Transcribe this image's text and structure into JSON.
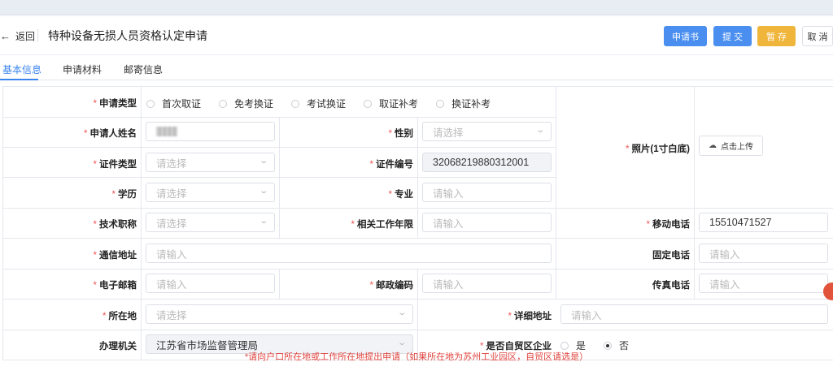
{
  "header": {
    "back_icon": "←",
    "back_label": "返回",
    "title": "特种设备无损人员资格认定申请",
    "buttons": {
      "apply_doc": "申请书",
      "submit": "提 交",
      "save_draft": "暂 存",
      "cancel": "取 消"
    },
    "colors": {
      "primary": "#4a8ff0",
      "warning": "#f0b53b"
    }
  },
  "tabs": [
    {
      "label": "基本信息",
      "active": true
    },
    {
      "label": "申请材料",
      "active": false
    },
    {
      "label": "邮寄信息",
      "active": false
    }
  ],
  "form": {
    "apply_type": {
      "label": "申请类型",
      "options": [
        "首次取证",
        "免考换证",
        "考试换证",
        "取证补考",
        "换证补考"
      ]
    },
    "applicant_name": {
      "label": "申请人姓名",
      "value": ""
    },
    "gender": {
      "label": "性别",
      "placeholder": "请选择"
    },
    "photo": {
      "label": "照片(1寸白底)",
      "upload_label": "点击上传",
      "upload_icon": "cloud-upload-icon"
    },
    "id_type": {
      "label": "证件类型",
      "placeholder": "请选择"
    },
    "id_number": {
      "label": "证件编号",
      "value": "32068219880312001"
    },
    "education": {
      "label": "学历",
      "placeholder": "请选择"
    },
    "major": {
      "label": "专业",
      "placeholder": "请输入"
    },
    "title": {
      "label": "技术职称",
      "placeholder": "请选择"
    },
    "work_years": {
      "label": "相关工作年限",
      "placeholder": "请输入"
    },
    "mobile": {
      "label": "移动电话",
      "value": "15510471527"
    },
    "address": {
      "label": "通信地址",
      "placeholder": "请输入"
    },
    "landline": {
      "label": "固定电话",
      "placeholder": "请输入"
    },
    "email": {
      "label": "电子邮箱",
      "placeholder": "请输入"
    },
    "postcode": {
      "label": "邮政编码",
      "placeholder": "请输入"
    },
    "fax": {
      "label": "传真电话",
      "placeholder": "请输入"
    },
    "location": {
      "label": "所在地",
      "placeholder": "请选择"
    },
    "detail_address": {
      "label": "详细地址",
      "placeholder": "请输入"
    },
    "authority": {
      "label": "办理机关",
      "value": "江苏省市场监督管理局"
    },
    "ftz": {
      "label": "是否自贸区企业",
      "options": [
        "是",
        "否"
      ],
      "selected": "否"
    }
  },
  "note": "*请向户口所在地或工作所在地提出申请（如果所在地为苏州工业园区，自贸区请选是）"
}
